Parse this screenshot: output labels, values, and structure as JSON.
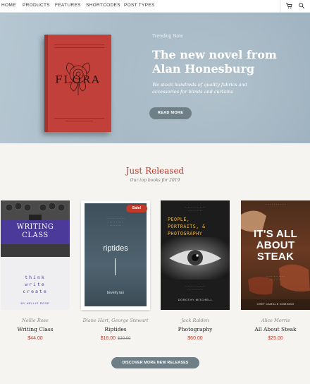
{
  "nav": {
    "items": [
      "HOME",
      "PRODUCTS",
      "FEATURES",
      "SHORTCODES",
      "POST TYPES"
    ],
    "icons": [
      "cart-icon",
      "search-icon"
    ]
  },
  "hero": {
    "book_title": "FLORA",
    "kicker": "Trending Now",
    "title_line1": "The new novel from",
    "title_line2": "Alan Honesburg",
    "subtitle": "We stock hundreds of quality fabrics and accessories for blinds and curtains",
    "button": "READ MORE"
  },
  "section": {
    "title": "Just Released",
    "subtitle": "Our top books for 2019"
  },
  "products": [
    {
      "author": "Nellie Rose",
      "title": "Writing Class",
      "price": "$44.00",
      "cover_title": "WRITING CLASS",
      "cover_lines": [
        "think",
        "write",
        "create"
      ],
      "cover_author": "BY NELLIE ROSE"
    },
    {
      "author": "Diane Hart, George Stewart",
      "title": "Riptides",
      "price": "$16.00",
      "old_price": "$20.00",
      "badge": "Sale!",
      "cover_title": "riptides",
      "cover_author": "beverly tan"
    },
    {
      "author": "Jack Ralden",
      "title": "Photography",
      "price": "$60.00",
      "cover_title": "PEOPLE, PORTRAITS, & PHOTOGRAPHY",
      "cover_author": "DOROTHY MITCHELL"
    },
    {
      "author": "Alice Morris",
      "title": "All About Steak",
      "price": "$25.00",
      "cover_title": "IT'S ALL ABOUT STEAK",
      "cover_author": "CHEF CAMILLE DOMINGO"
    }
  ],
  "cta": "DISCOVER MORE NEW RELEASES"
}
